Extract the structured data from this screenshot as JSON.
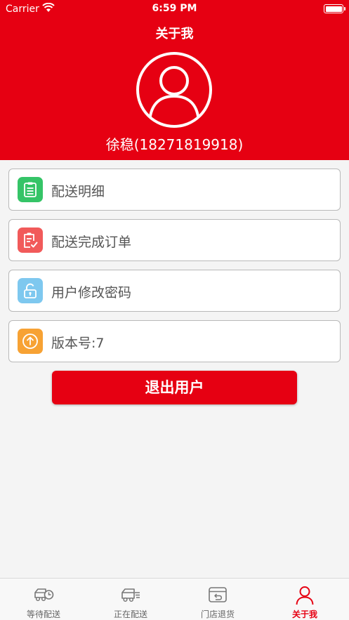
{
  "status_bar": {
    "carrier": "Carrier",
    "time": "6:59 PM"
  },
  "header": {
    "title": "关于我",
    "user_name": "徐稳(18271819918)"
  },
  "menu": [
    {
      "label": "配送明细",
      "icon": "clipboard-list-icon",
      "color": "#35c467"
    },
    {
      "label": "配送完成订单",
      "icon": "clipboard-check-icon",
      "color": "#f15a5a"
    },
    {
      "label": "用户修改密码",
      "icon": "lock-icon",
      "color": "#7ec8ef"
    },
    {
      "label": "版本号:7",
      "icon": "arrow-up-circle-icon",
      "color": "#f7a234"
    }
  ],
  "logout_label": "退出用户",
  "tabs": [
    {
      "label": "等待配送",
      "icon": "truck-clock-icon",
      "active": false
    },
    {
      "label": "正在配送",
      "icon": "truck-moving-icon",
      "active": false
    },
    {
      "label": "门店退货",
      "icon": "return-box-icon",
      "active": false
    },
    {
      "label": "关于我",
      "icon": "user-icon",
      "active": true
    }
  ],
  "colors": {
    "brand": "#e60012",
    "background": "#f4f4f4",
    "tab_inactive": "#666666"
  }
}
